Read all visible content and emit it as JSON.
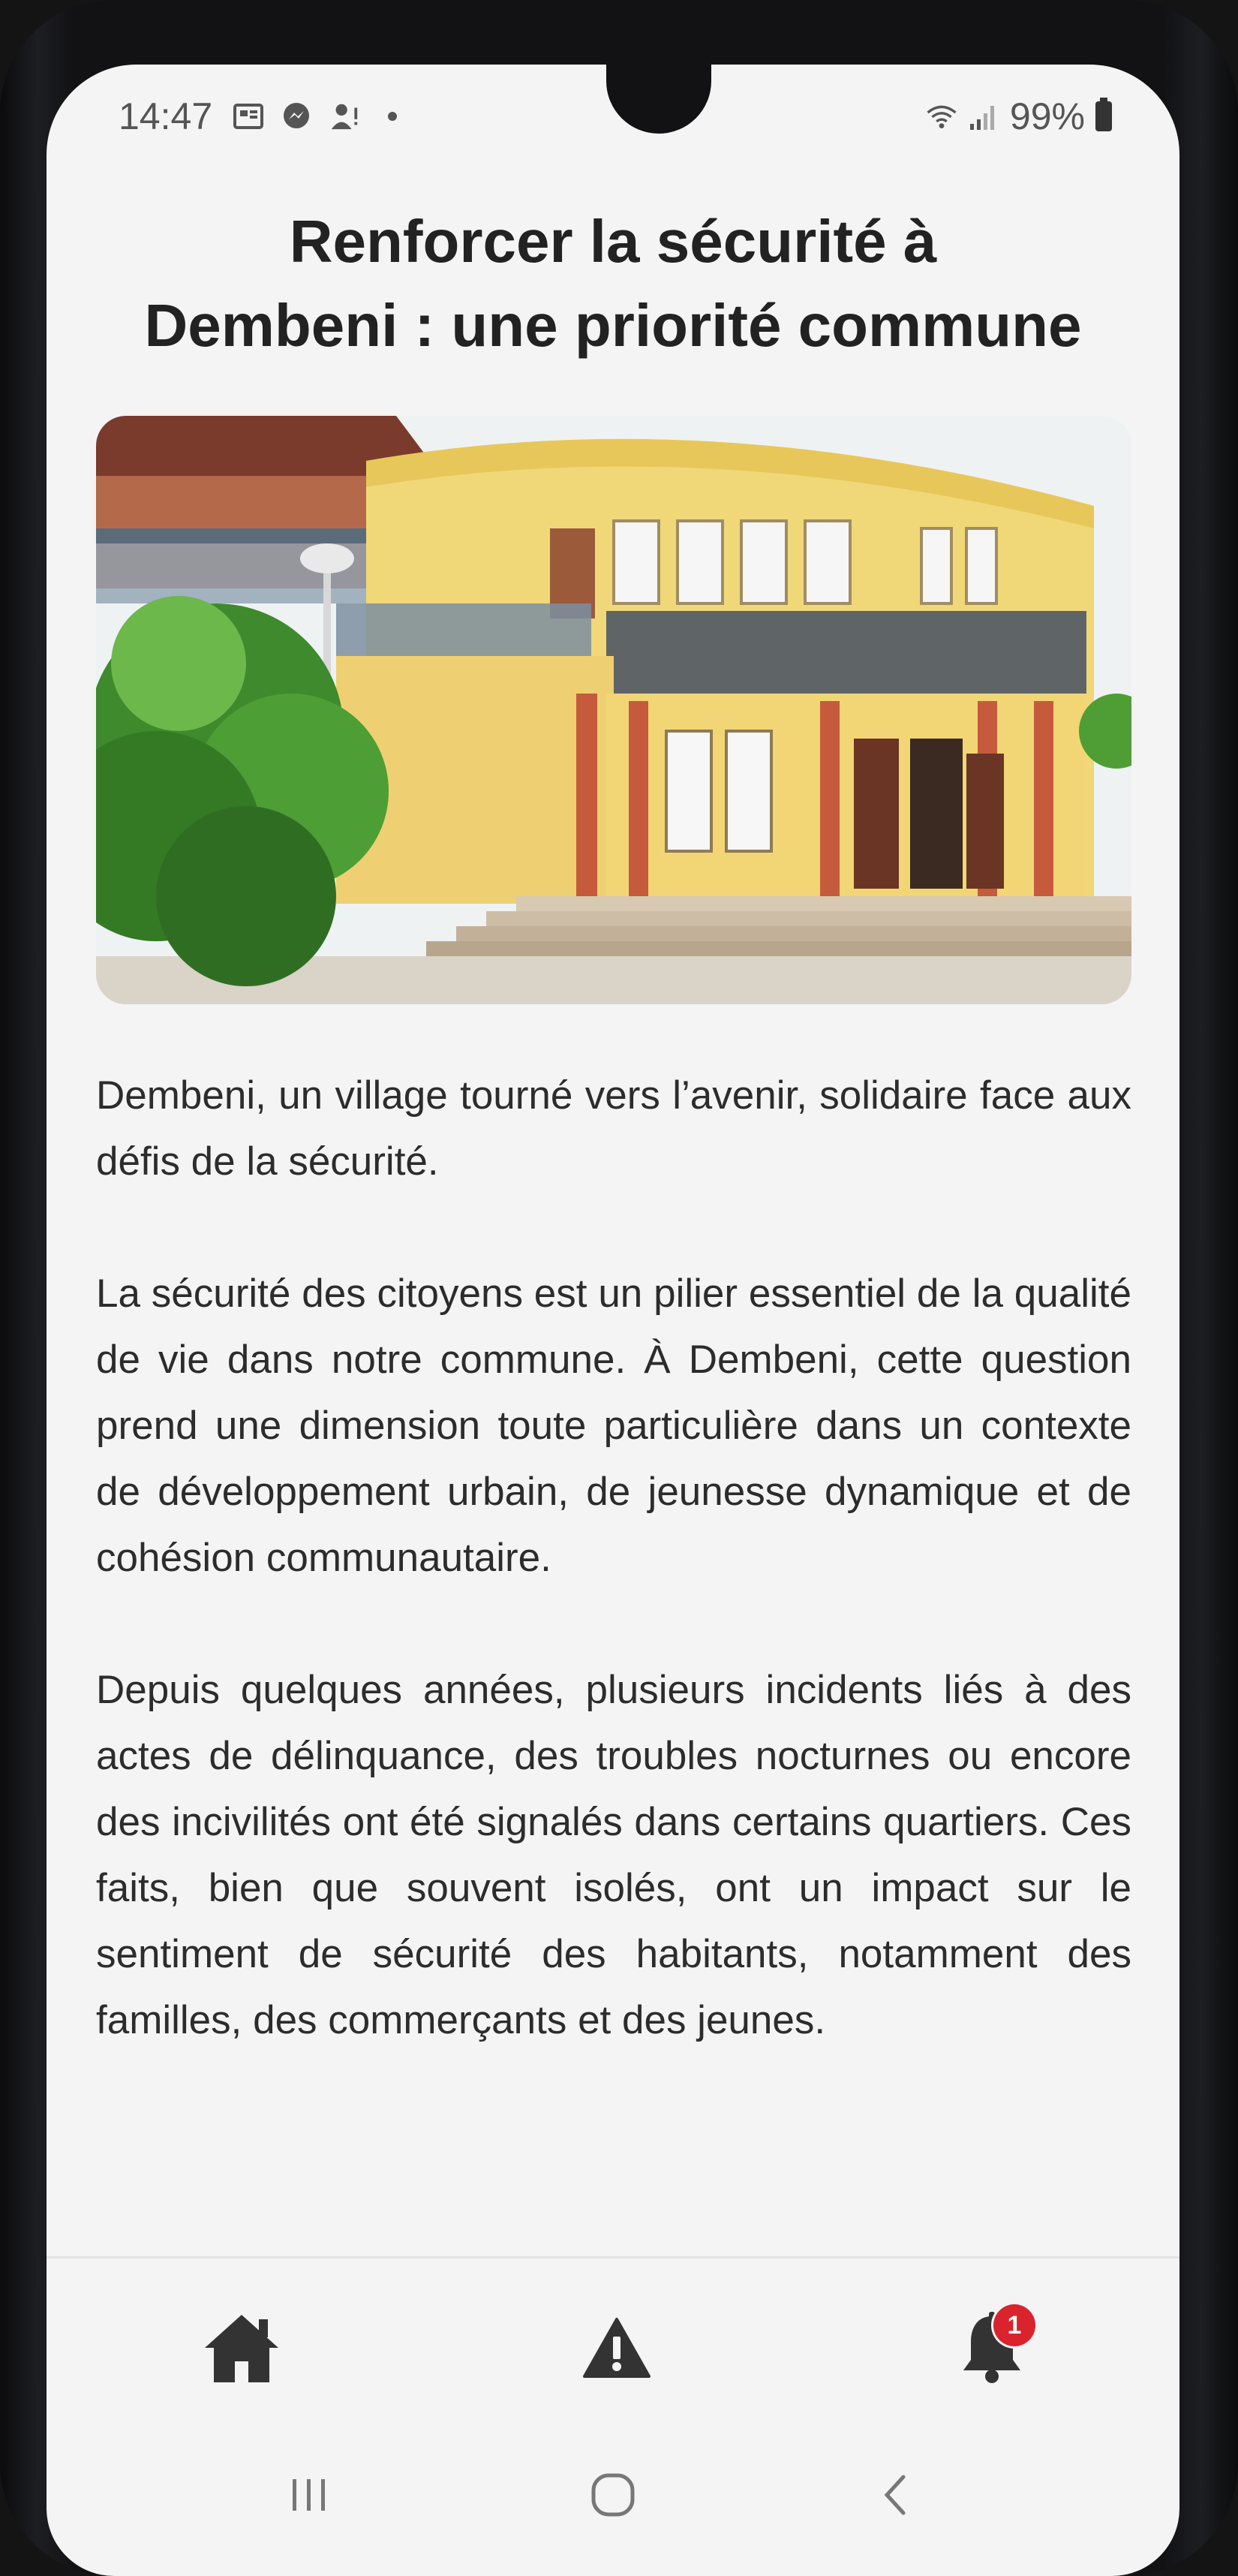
{
  "status_bar": {
    "time": "14:47",
    "battery": "99%",
    "left_icons": [
      "gallery-icon",
      "messenger-icon",
      "person-alert-icon",
      "dot-icon"
    ],
    "right_icons": [
      "wifi-icon",
      "signal-icon",
      "battery-icon"
    ]
  },
  "article": {
    "title_line1": "Renforcer la sécurité à",
    "title_line2": "Dembeni : une priorité commune",
    "image_icon": "town-hall-building-photo",
    "paragraphs": [
      "Dembeni, un village tourné vers l’avenir, solidaire face aux défis de la sécurité.",
      "La sécurité des citoyens est un pilier essentiel de la qualité de vie dans notre commune. À Dembeni, cette question prend une dimension toute particulière dans un contexte de développement urbain, de jeunesse dynamique et de cohésion communautaire.",
      "Depuis quelques années, plusieurs incidents liés à des actes de délinquance, des troubles nocturnes ou encore des incivilités ont été signalés dans certains quartiers. Ces faits, bien que souvent isolés, ont un impact sur le sentiment de sécurité des habitants, notamment des familles, des commerçants et des jeunes."
    ]
  },
  "bottom_nav": {
    "items": [
      {
        "icon": "home-icon"
      },
      {
        "icon": "warning-icon"
      },
      {
        "icon": "bell-icon"
      }
    ],
    "notification_count": "1",
    "badge_color": "#d9232d"
  },
  "system_nav": {
    "icons": [
      "recent-apps-icon",
      "home-circle-icon",
      "back-icon"
    ]
  },
  "colors": {
    "text": "#2c2c2c",
    "icon": "#333333",
    "background": "#f4f4f4"
  }
}
